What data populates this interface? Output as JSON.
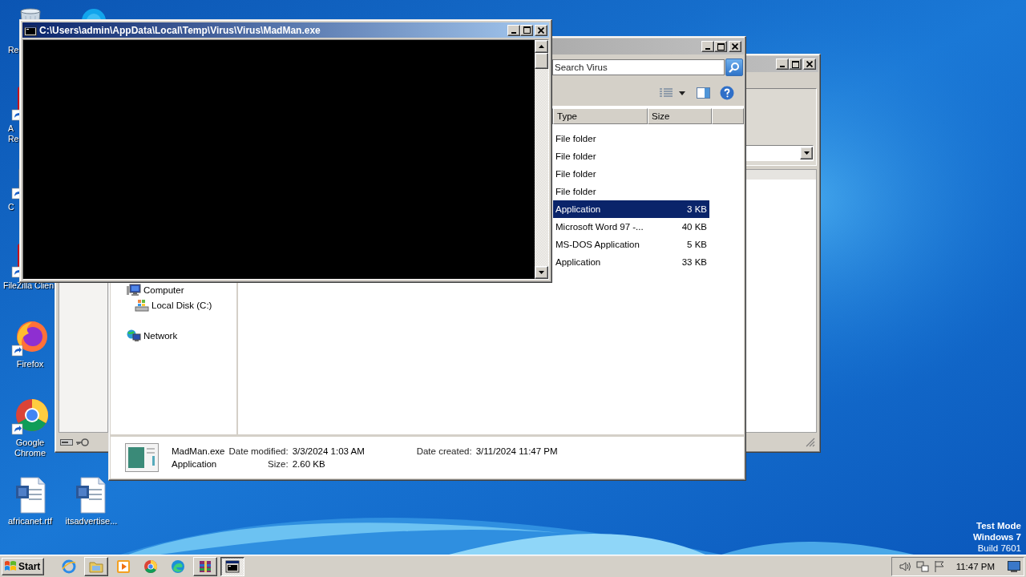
{
  "desktop": {
    "icons": [
      {
        "kind": "recycle-bin",
        "label": "Re"
      },
      {
        "kind": "round-app"
      },
      {
        "kind": "red-app",
        "label": "A Re"
      },
      {
        "kind": "plain-app",
        "label": "C"
      },
      {
        "kind": "red-app",
        "label": "FileZilla Clien"
      },
      {
        "kind": "firefox",
        "label": "Firefox"
      },
      {
        "kind": "chrome",
        "label": "Google Chrome"
      },
      {
        "kind": "word-doc",
        "label": "africanet.rtf"
      },
      {
        "kind": "word-doc",
        "label": "itsadvertise..."
      }
    ],
    "os_notice": [
      "Test Mode",
      "Windows 7",
      "Build 7601"
    ]
  },
  "console": {
    "title": "C:\\Users\\admin\\AppData\\Local\\Temp\\Virus\\Virus\\MadMan.exe"
  },
  "explorer": {
    "search": {
      "placeholder": "Search Virus"
    },
    "columns": [
      "Type",
      "Size"
    ],
    "rows": [
      {
        "type": "File folder",
        "selected": false
      },
      {
        "type": "File folder",
        "selected": false
      },
      {
        "type": "File folder",
        "selected": false
      },
      {
        "type": "File folder",
        "selected": false
      },
      {
        "type": "Application",
        "size": "3 KB",
        "selected": true
      },
      {
        "type": "Microsoft Word 97 -...",
        "size": "40 KB",
        "selected": false
      },
      {
        "type": "MS-DOS Application",
        "size": "5 KB",
        "selected": false
      },
      {
        "type": "Application",
        "size": "33 KB",
        "selected": false
      }
    ],
    "nav": [
      {
        "kind": "computer",
        "label": "Computer",
        "children": [
          {
            "kind": "disk",
            "label": "Local Disk (C:)"
          }
        ]
      },
      {
        "kind": "network",
        "label": "Network"
      }
    ],
    "details": {
      "name": "MadMan.exe",
      "type": "Application",
      "date_modified_label": "Date modified:",
      "date_modified": "3/3/2024 1:03 AM",
      "size_label": "Size:",
      "size": "2.60 KB",
      "date_created_label": "Date created:",
      "date_created": "3/11/2024 11:47 PM"
    }
  },
  "taskbar": {
    "start": "Start",
    "apps": [
      {
        "kind": "ie",
        "running": false,
        "selected": false
      },
      {
        "kind": "folder",
        "running": true,
        "selected": false
      },
      {
        "kind": "media",
        "running": false,
        "selected": false
      },
      {
        "kind": "chrome",
        "running": false,
        "selected": false
      },
      {
        "kind": "edge",
        "running": false,
        "selected": false
      },
      {
        "kind": "archive",
        "running": true,
        "selected": false
      },
      {
        "kind": "console",
        "running": true,
        "selected": true
      }
    ],
    "clock": "11:47 PM"
  }
}
